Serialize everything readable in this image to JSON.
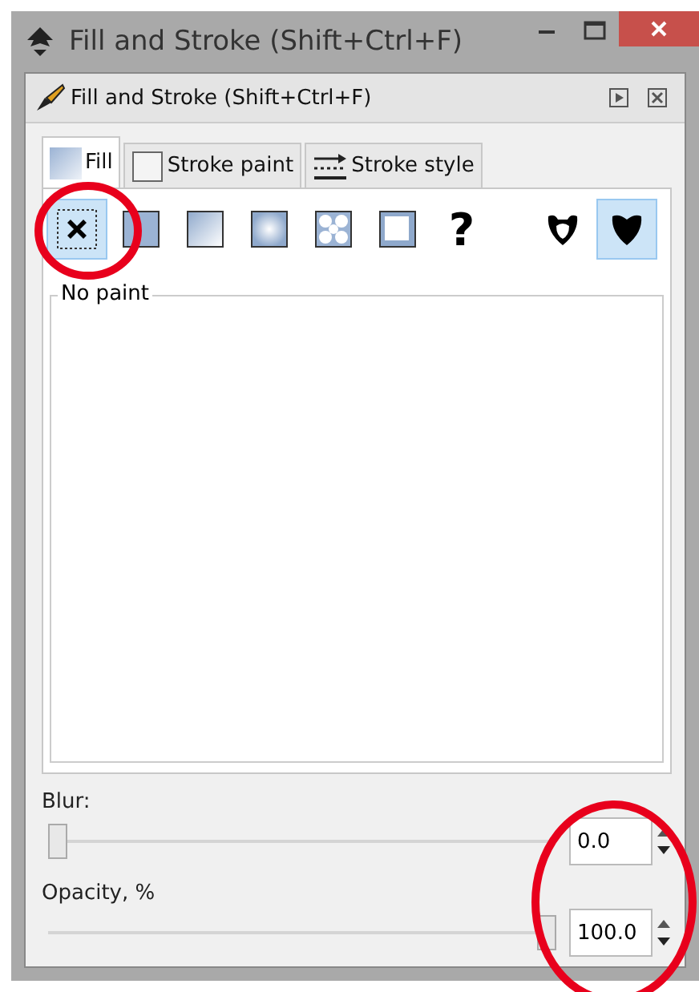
{
  "window": {
    "title": "Fill and Stroke (Shift+Ctrl+F)"
  },
  "dock": {
    "title": "Fill and Stroke (Shift+Ctrl+F)"
  },
  "tabs": [
    {
      "label": "Fill",
      "kind": "fill",
      "selected": true
    },
    {
      "label": "Stroke paint",
      "kind": "stroke-paint",
      "selected": false
    },
    {
      "label": "Stroke style",
      "kind": "stroke-style",
      "selected": false
    }
  ],
  "paint_types": [
    {
      "kind": "none",
      "selected": true
    },
    {
      "kind": "flat",
      "selected": false
    },
    {
      "kind": "linear",
      "selected": false
    },
    {
      "kind": "radial",
      "selected": false
    },
    {
      "kind": "pattern",
      "selected": false
    },
    {
      "kind": "swatch",
      "selected": false
    },
    {
      "kind": "unset",
      "label": "?",
      "selected": false
    }
  ],
  "fill_rules": [
    {
      "kind": "evenodd",
      "selected": false
    },
    {
      "kind": "nonzero",
      "selected": true
    }
  ],
  "paint_frame": {
    "label": "No paint"
  },
  "blur": {
    "label": "Blur:",
    "level": 0,
    "value": "0.0"
  },
  "opacity": {
    "label": "Opacity, %",
    "level": 1,
    "value": "100.0"
  }
}
